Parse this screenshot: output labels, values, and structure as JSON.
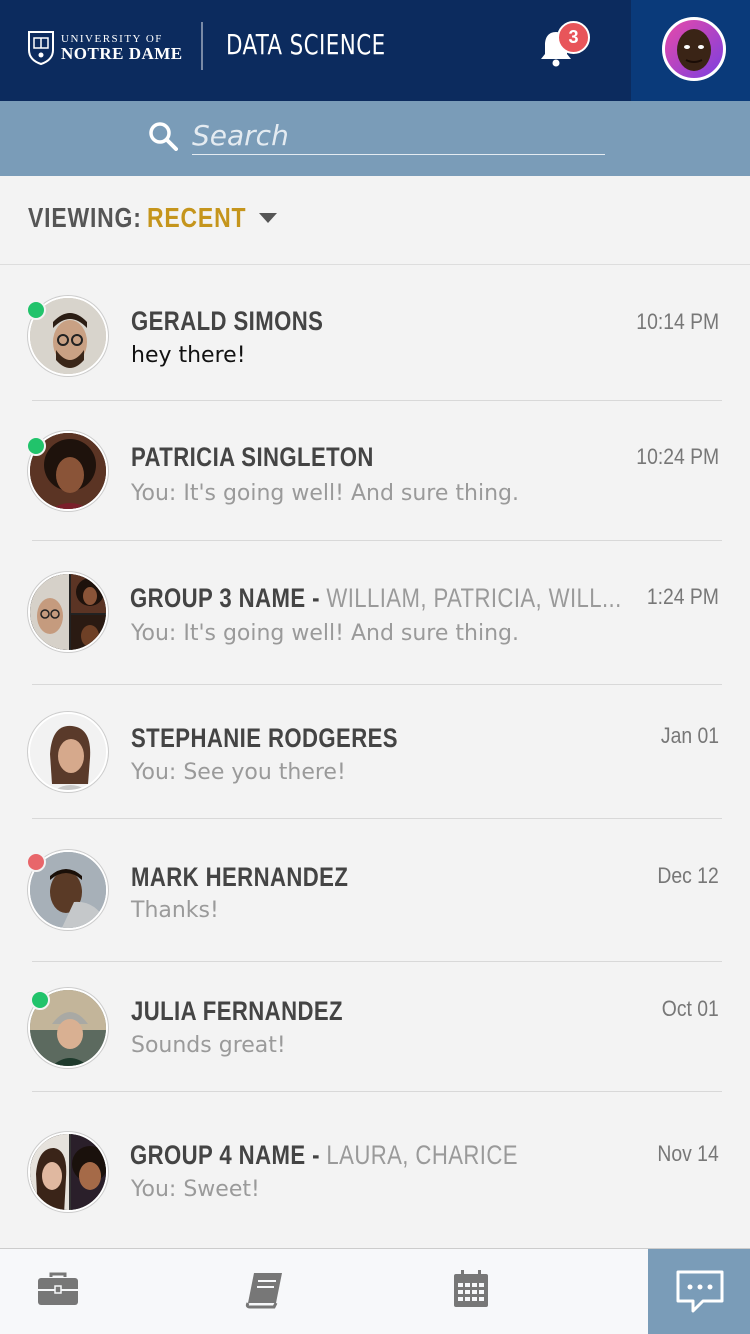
{
  "header": {
    "logo_line1": "UNIVERSITY OF",
    "logo_line2": "NOTRE DAME",
    "app_title": "DATA SCIENCE",
    "notification_count": "3"
  },
  "search": {
    "placeholder": "Search"
  },
  "viewing": {
    "label": "VIEWING:",
    "value": "RECENT"
  },
  "conversations": [
    {
      "name": "GERALD SIMONS",
      "members": "",
      "message": "hey there!",
      "time": "10:14 PM",
      "status": "online"
    },
    {
      "name": "PATRICIA SINGLETON",
      "members": "",
      "message": "You: It's going well! And sure thing.",
      "time": "10:24 PM",
      "status": "online"
    },
    {
      "name": "GROUP 3 NAME -",
      "members": "WILLIAM, PATRICIA, WILL...",
      "message": "You: It's going well! And sure thing.",
      "time": "1:24 PM",
      "status": "none"
    },
    {
      "name": "STEPHANIE RODGERES",
      "members": "",
      "message": "You: See you there!",
      "time": "Jan 01",
      "status": "none"
    },
    {
      "name": "MARK HERNANDEZ",
      "members": "",
      "message": "Thanks!",
      "time": "Dec 12",
      "status": "busy"
    },
    {
      "name": "JULIA FERNANDEZ",
      "members": "",
      "message": "Sounds great!",
      "time": "Oct 01",
      "status": "online"
    },
    {
      "name": "GROUP 4 NAME -",
      "members": "LAURA, CHARICE",
      "message": "You: Sweet!",
      "time": "Nov 14",
      "status": "none"
    }
  ],
  "colors": {
    "header_bg": "#0c2b5e",
    "search_bg": "#7a9cb8",
    "accent_gold": "#c5951c",
    "online": "#21c36b",
    "busy": "#e8666a",
    "badge": "#e8555a"
  },
  "bottom_nav": [
    {
      "icon": "briefcase-icon"
    },
    {
      "icon": "book-icon"
    },
    {
      "icon": "calendar-icon"
    },
    {
      "icon": "chat-icon",
      "active": true
    }
  ]
}
